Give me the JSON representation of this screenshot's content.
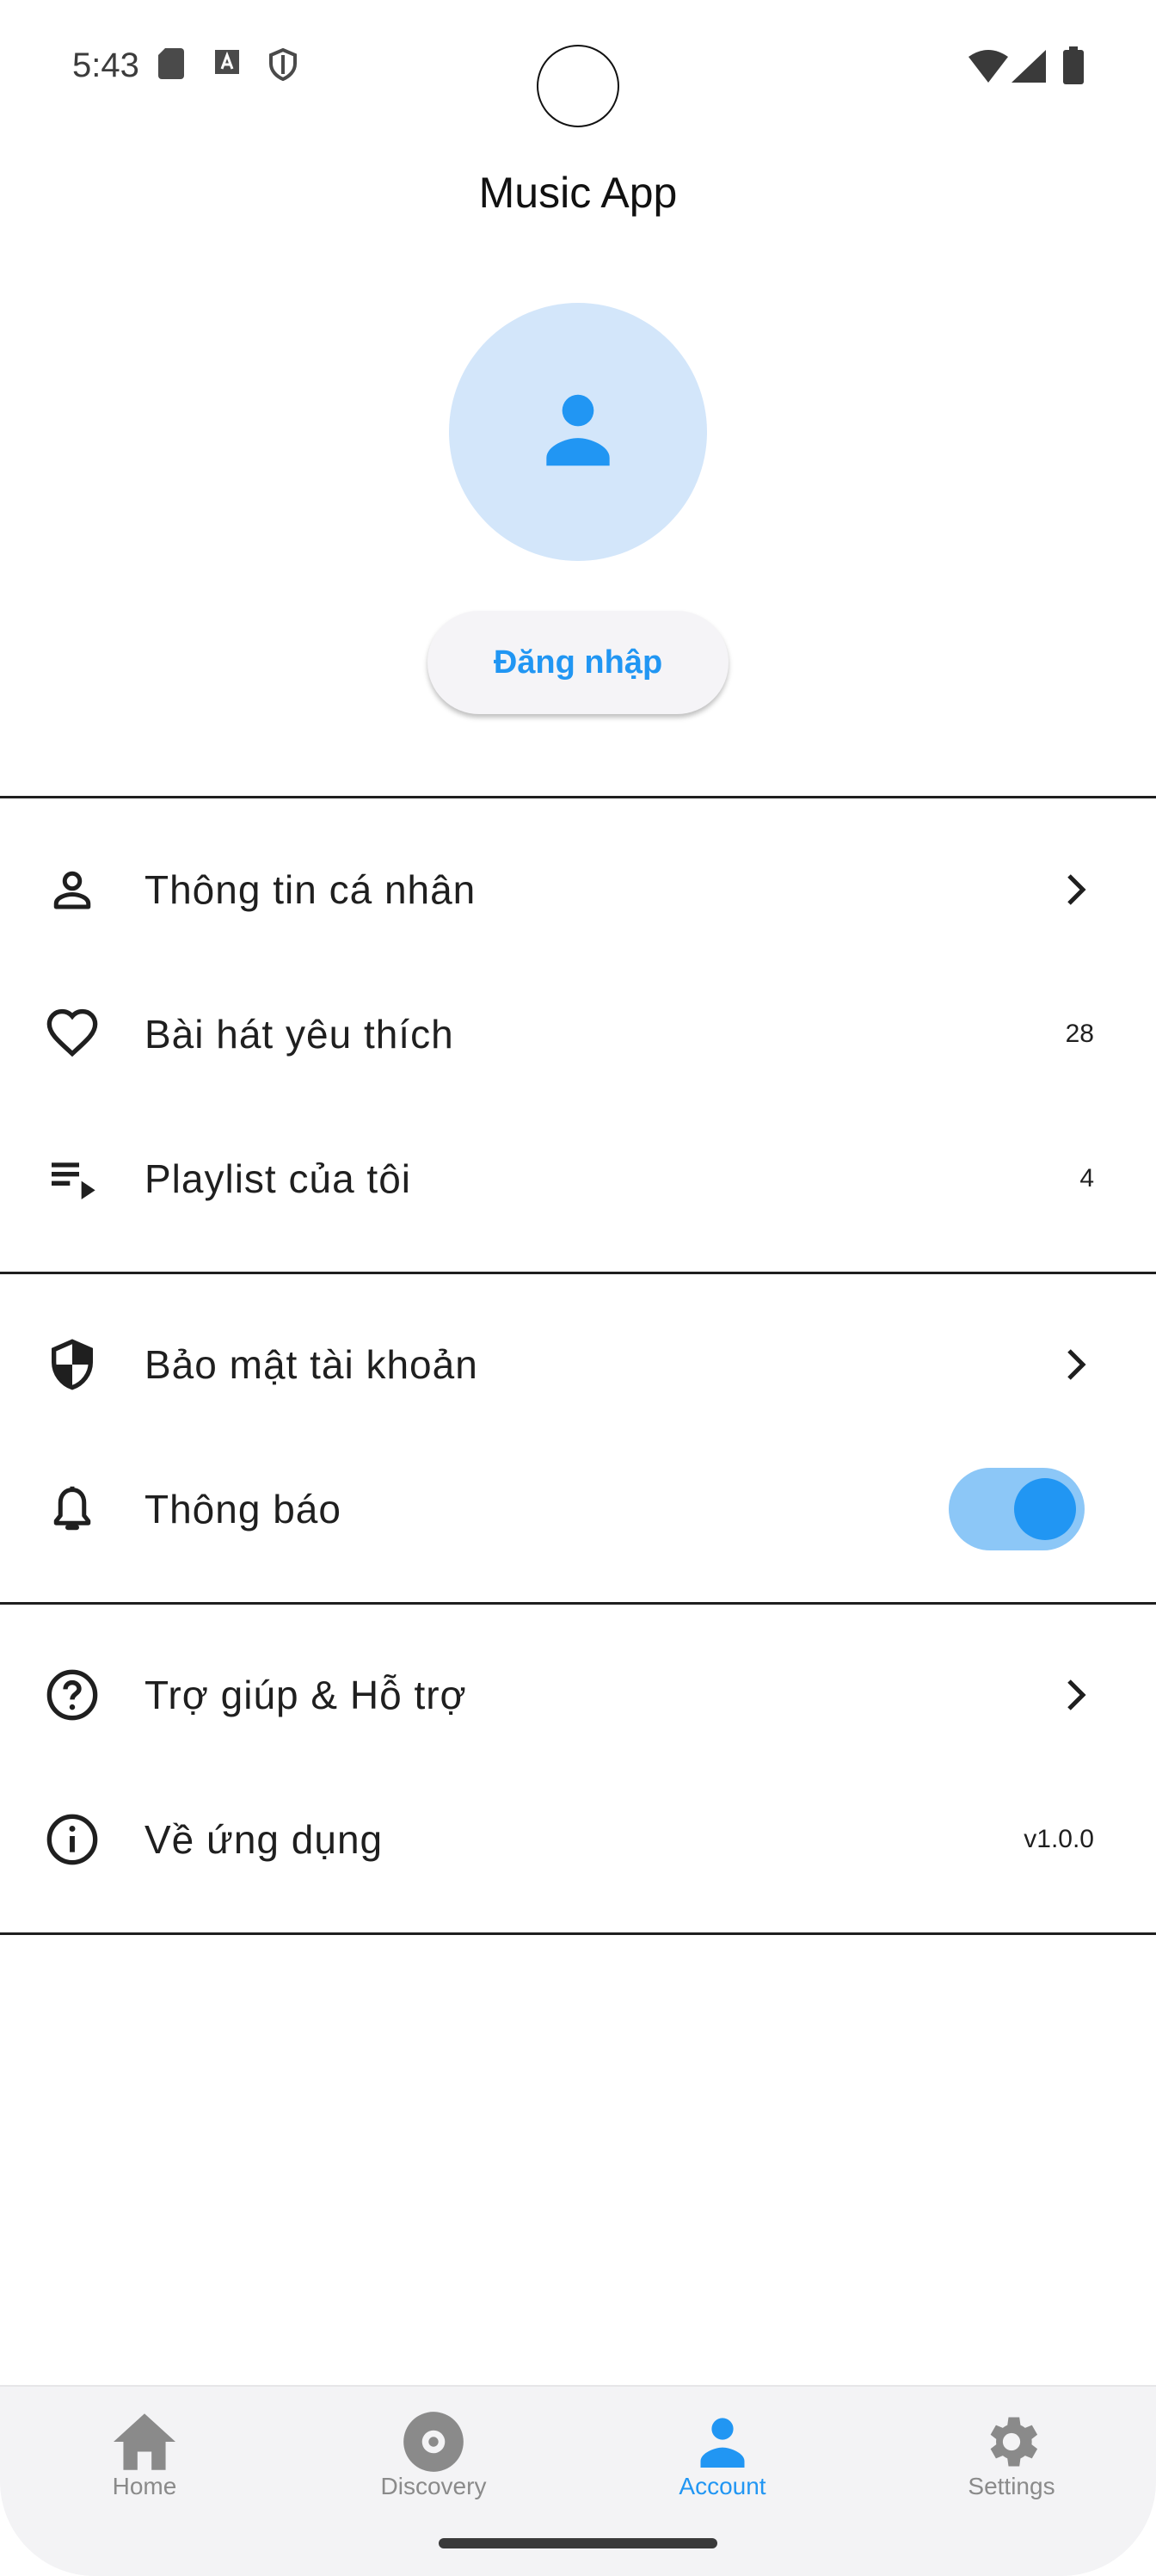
{
  "status_bar": {
    "time": "5:43",
    "left_icons": [
      "sd-card-icon",
      "text-a-icon",
      "shield-outline-icon"
    ],
    "right_icons": [
      "wifi-icon",
      "signal-icon",
      "battery-icon"
    ]
  },
  "app_bar": {
    "title": "Music App"
  },
  "profile": {
    "avatar_icon": "person-icon",
    "login_label": "Đăng nhập"
  },
  "menu": {
    "personal_info": {
      "label": "Thông tin cá nhân",
      "icon": "person-outline-icon"
    },
    "favorite_songs": {
      "label": "Bài hát yêu thích",
      "icon": "heart-outline-icon",
      "count": "28"
    },
    "my_playlists": {
      "label": "Playlist của tôi",
      "icon": "playlist-icon",
      "count": "4"
    },
    "account_security": {
      "label": "Bảo mật tài khoản",
      "icon": "shield-icon"
    },
    "notifications": {
      "label": "Thông báo",
      "icon": "bell-icon",
      "enabled": true
    },
    "help_support": {
      "label": "Trợ giúp & Hỗ trợ",
      "icon": "help-circle-icon"
    },
    "about_app": {
      "label": "Về ứng dụng",
      "icon": "info-circle-icon",
      "version": "v1.0.0"
    }
  },
  "bottom_nav": {
    "items": [
      {
        "label": "Home",
        "icon": "home-icon",
        "active": false
      },
      {
        "label": "Discovery",
        "icon": "disc-icon",
        "active": false
      },
      {
        "label": "Account",
        "icon": "person-icon",
        "active": true
      },
      {
        "label": "Settings",
        "icon": "gear-icon",
        "active": false
      }
    ]
  },
  "colors": {
    "accent": "#2196f3",
    "avatar_bg": "#d3e6fa",
    "toggle_track": "#8cc7f7",
    "nav_inactive": "#8a8a8a"
  }
}
